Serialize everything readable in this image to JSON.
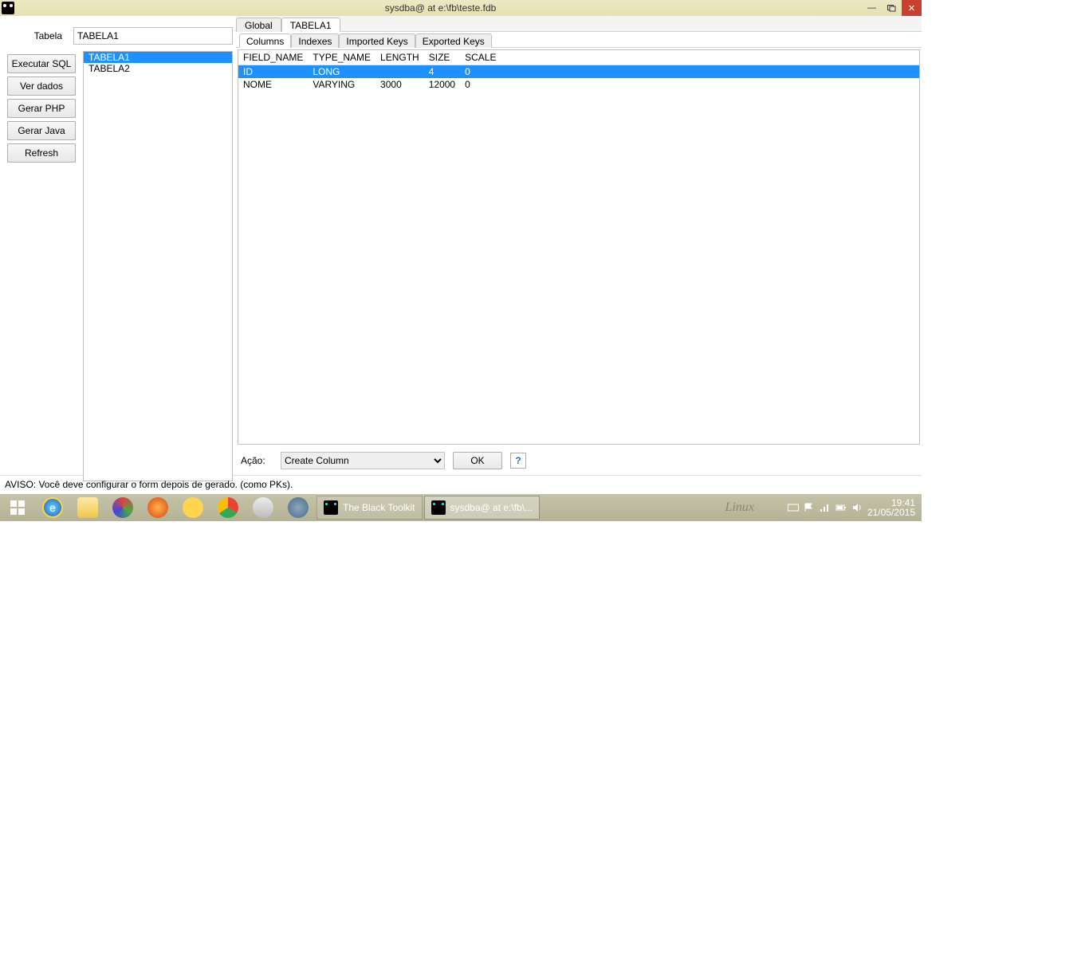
{
  "titlebar": {
    "text": "sysdba@ at e:\\fb\\teste.fdb"
  },
  "sidebar": {
    "tabela_label": "Tabela",
    "tabela_value": "TABELA1",
    "buttons": {
      "executar_sql": "Executar SQL",
      "ver_dados": "Ver dados",
      "gerar_php": "Gerar PHP",
      "gerar_java": "Gerar Java",
      "refresh": "Refresh"
    },
    "tables": [
      "TABELA1",
      "TABELA2"
    ],
    "selected_table_index": 0
  },
  "tabs": [
    "Global",
    "TABELA1"
  ],
  "active_tab_index": 1,
  "subtabs": [
    "Columns",
    "Indexes",
    "Imported Keys",
    "Exported Keys"
  ],
  "active_subtab_index": 0,
  "grid": {
    "headers": [
      "FIELD_NAME",
      "TYPE_NAME",
      "LENGTH",
      "SIZE",
      "SCALE"
    ],
    "rows": [
      {
        "field_name": "ID",
        "type_name": "LONG",
        "length": "",
        "size": "4",
        "scale": "0"
      },
      {
        "field_name": "NOME",
        "type_name": "VARYING",
        "length": "3000",
        "size": "12000",
        "scale": "0"
      }
    ],
    "selected_row_index": 0
  },
  "action": {
    "label": "Ação:",
    "selected": "Create Column",
    "ok": "OK",
    "help": "?"
  },
  "status": "AVISO: Você deve configurar o form depois de gerado. (como PKs).",
  "taskbar": {
    "app1": "The Black Toolkit",
    "app2": "sysdba@ at e:\\fb\\...",
    "time": "19:41",
    "date": "21/05/2015",
    "brand": "Linux"
  }
}
